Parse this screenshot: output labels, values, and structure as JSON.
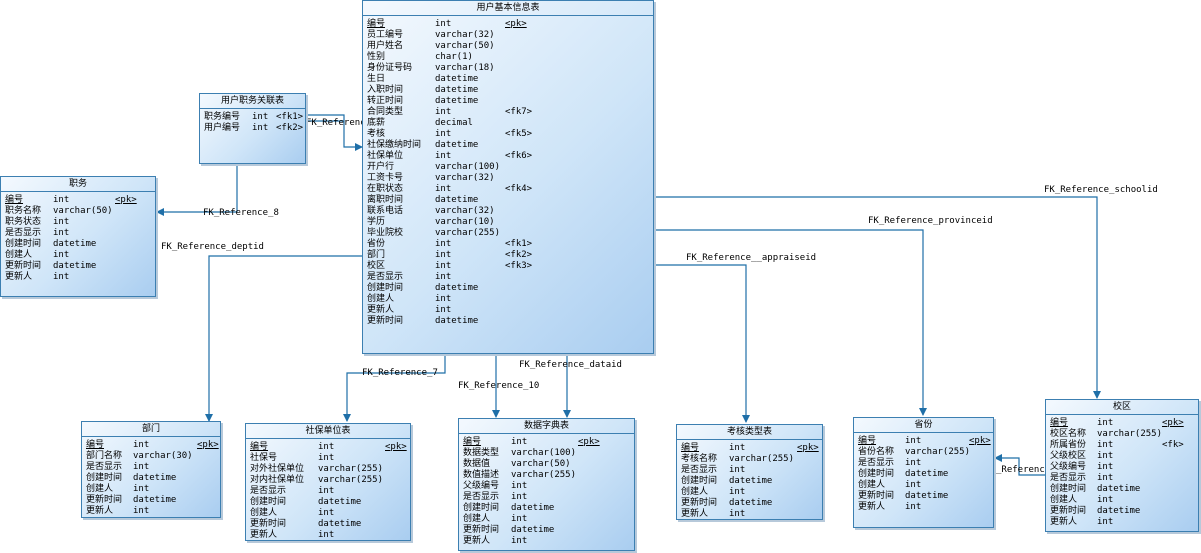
{
  "entities": {
    "user": {
      "title": "用户基本信息表",
      "columns": [
        {
          "name": "编号",
          "type": "int",
          "key": "<pk>",
          "pk": true
        },
        {
          "name": "员工编号",
          "type": "varchar(32)",
          "key": ""
        },
        {
          "name": "用户姓名",
          "type": "varchar(50)",
          "key": ""
        },
        {
          "name": "性别",
          "type": "char(1)",
          "key": ""
        },
        {
          "name": "身份证号码",
          "type": "varchar(18)",
          "key": ""
        },
        {
          "name": "生日",
          "type": "datetime",
          "key": ""
        },
        {
          "name": "入职时间",
          "type": "datetime",
          "key": ""
        },
        {
          "name": "转正时间",
          "type": "datetime",
          "key": ""
        },
        {
          "name": "合同类型",
          "type": "int",
          "key": "<fk7>"
        },
        {
          "name": "底薪",
          "type": "decimal",
          "key": ""
        },
        {
          "name": "考核",
          "type": "int",
          "key": "<fk5>"
        },
        {
          "name": "社保缴纳时间",
          "type": "datetime",
          "key": ""
        },
        {
          "name": "社保单位",
          "type": "int",
          "key": "<fk6>"
        },
        {
          "name": "开户行",
          "type": "varchar(100)",
          "key": ""
        },
        {
          "name": "工资卡号",
          "type": "varchar(32)",
          "key": ""
        },
        {
          "name": "在职状态",
          "type": "int",
          "key": "<fk4>"
        },
        {
          "name": "离职时间",
          "type": "datetime",
          "key": ""
        },
        {
          "name": "联系电话",
          "type": "varchar(32)",
          "key": ""
        },
        {
          "name": "学历",
          "type": "varchar(10)",
          "key": ""
        },
        {
          "name": "毕业院校",
          "type": "varchar(255)",
          "key": ""
        },
        {
          "name": "省份",
          "type": "int",
          "key": "<fk1>"
        },
        {
          "name": "部门",
          "type": "int",
          "key": "<fk2>"
        },
        {
          "name": "校区",
          "type": "int",
          "key": "<fk3>"
        },
        {
          "name": "是否显示",
          "type": "int",
          "key": ""
        },
        {
          "name": "创建时间",
          "type": "datetime",
          "key": ""
        },
        {
          "name": "创建人",
          "type": "int",
          "key": ""
        },
        {
          "name": "更新人",
          "type": "int",
          "key": ""
        },
        {
          "name": "更新时间",
          "type": "datetime",
          "key": ""
        }
      ]
    },
    "user_job": {
      "title": "用户职务关联表",
      "columns": [
        {
          "name": "职务编号",
          "type": "int",
          "key": "<fk1>"
        },
        {
          "name": "用户编号",
          "type": "int",
          "key": "<fk2>"
        }
      ]
    },
    "job": {
      "title": "职务",
      "columns": [
        {
          "name": "编号",
          "type": "int",
          "key": "<pk>",
          "pk": true
        },
        {
          "name": "职务名称",
          "type": "varchar(50)",
          "key": ""
        },
        {
          "name": "职务状态",
          "type": "int",
          "key": ""
        },
        {
          "name": "是否显示",
          "type": "int",
          "key": ""
        },
        {
          "name": "创建时间",
          "type": "datetime",
          "key": ""
        },
        {
          "name": "创建人",
          "type": "int",
          "key": ""
        },
        {
          "name": "更新时间",
          "type": "datetime",
          "key": ""
        },
        {
          "name": "更新人",
          "type": "int",
          "key": ""
        }
      ]
    },
    "dept": {
      "title": "部门",
      "columns": [
        {
          "name": "编号",
          "type": "int",
          "key": "<pk>",
          "pk": true
        },
        {
          "name": "部门名称",
          "type": "varchar(30)",
          "key": ""
        },
        {
          "name": "是否显示",
          "type": "int",
          "key": ""
        },
        {
          "name": "创建时间",
          "type": "datetime",
          "key": ""
        },
        {
          "name": "创建人",
          "type": "int",
          "key": ""
        },
        {
          "name": "更新时间",
          "type": "datetime",
          "key": ""
        },
        {
          "name": "更新人",
          "type": "int",
          "key": ""
        }
      ]
    },
    "social": {
      "title": "社保单位表",
      "columns": [
        {
          "name": "编号",
          "type": "int",
          "key": "<pk>",
          "pk": true
        },
        {
          "name": "社保号",
          "type": "int",
          "key": ""
        },
        {
          "name": "对外社保单位",
          "type": "varchar(255)",
          "key": ""
        },
        {
          "name": "对内社保单位",
          "type": "varchar(255)",
          "key": ""
        },
        {
          "name": "是否显示",
          "type": "int",
          "key": ""
        },
        {
          "name": "创建时间",
          "type": "datetime",
          "key": ""
        },
        {
          "name": "创建人",
          "type": "int",
          "key": ""
        },
        {
          "name": "更新时间",
          "type": "datetime",
          "key": ""
        },
        {
          "name": "更新人",
          "type": "int",
          "key": ""
        }
      ]
    },
    "dict": {
      "title": "数据字典表",
      "columns": [
        {
          "name": "编号",
          "type": "int",
          "key": "<pk>",
          "pk": true
        },
        {
          "name": "数据类型",
          "type": "varchar(100)",
          "key": ""
        },
        {
          "name": "数据值",
          "type": "varchar(50)",
          "key": ""
        },
        {
          "name": "数值描述",
          "type": "varchar(255)",
          "key": ""
        },
        {
          "name": "父级编号",
          "type": "int",
          "key": ""
        },
        {
          "name": "是否显示",
          "type": "int",
          "key": ""
        },
        {
          "name": "创建时间",
          "type": "datetime",
          "key": ""
        },
        {
          "name": "创建人",
          "type": "int",
          "key": ""
        },
        {
          "name": "更新时间",
          "type": "datetime",
          "key": ""
        },
        {
          "name": "更新人",
          "type": "int",
          "key": ""
        }
      ]
    },
    "appraise": {
      "title": "考核类型表",
      "columns": [
        {
          "name": "编号",
          "type": "int",
          "key": "<pk>",
          "pk": true
        },
        {
          "name": "考核名称",
          "type": "varchar(255)",
          "key": ""
        },
        {
          "name": "是否显示",
          "type": "int",
          "key": ""
        },
        {
          "name": "创建时间",
          "type": "datetime",
          "key": ""
        },
        {
          "name": "创建人",
          "type": "int",
          "key": ""
        },
        {
          "name": "更新时间",
          "type": "datetime",
          "key": ""
        },
        {
          "name": "更新人",
          "type": "int",
          "key": ""
        }
      ]
    },
    "province": {
      "title": "省份",
      "columns": [
        {
          "name": "编号",
          "type": "int",
          "key": "<pk>",
          "pk": true
        },
        {
          "name": "省份名称",
          "type": "varchar(255)",
          "key": ""
        },
        {
          "name": "是否显示",
          "type": "int",
          "key": ""
        },
        {
          "name": "创建时间",
          "type": "datetime",
          "key": ""
        },
        {
          "name": "创建人",
          "type": "int",
          "key": ""
        },
        {
          "name": "更新时间",
          "type": "datetime",
          "key": ""
        },
        {
          "name": "更新人",
          "type": "int",
          "key": ""
        }
      ]
    },
    "school": {
      "title": "校区",
      "columns": [
        {
          "name": "编号",
          "type": "int",
          "key": "<pk>",
          "pk": true
        },
        {
          "name": "校区名称",
          "type": "varchar(255)",
          "key": ""
        },
        {
          "name": "所属省份",
          "type": "int",
          "key": "<fk>"
        },
        {
          "name": "父级校区",
          "type": "int",
          "key": ""
        },
        {
          "name": "父级编号",
          "type": "int",
          "key": ""
        },
        {
          "name": "是否显示",
          "type": "int",
          "key": ""
        },
        {
          "name": "创建时间",
          "type": "datetime",
          "key": ""
        },
        {
          "name": "创建人",
          "type": "int",
          "key": ""
        },
        {
          "name": "更新时间",
          "type": "datetime",
          "key": ""
        },
        {
          "name": "更新人",
          "type": "int",
          "key": ""
        }
      ]
    }
  },
  "references": {
    "ref_top": "FK_Reference",
    "ref_8": "FK_Reference_8",
    "ref_deptid": "FK_Reference_deptid",
    "ref_7": "FK_Reference_7",
    "ref_10": "FK_Reference_10",
    "ref_dataid": "FK_Reference_dataid",
    "ref_appraiseid": "FK_Reference__appraiseid",
    "ref_provinceid": "FK_Reference_provinceid",
    "ref_schoolid": "FK_Reference_schoolid",
    "ref_province_school": "_Reference"
  },
  "colors": {
    "line": "#1f6fa8",
    "border": "#3c7fb1",
    "fill_light": "#f4f9fe",
    "fill_dark": "#a9cdf0"
  }
}
